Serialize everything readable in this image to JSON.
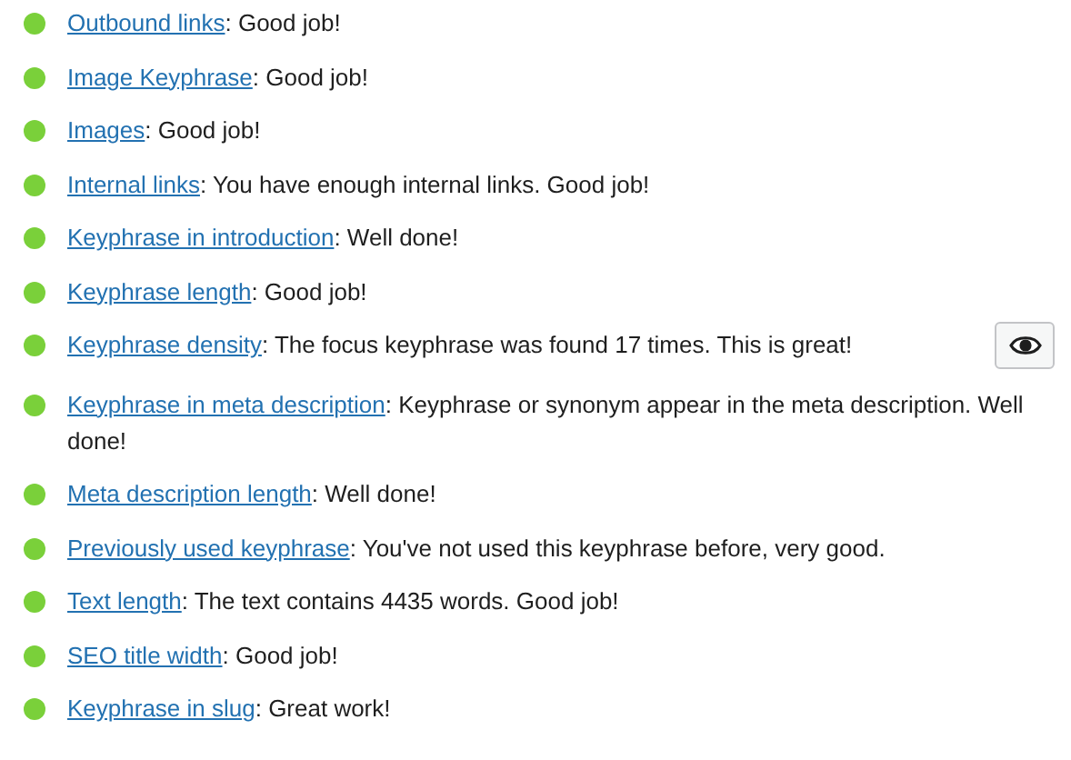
{
  "results": [
    {
      "link": "Outbound links",
      "text": ": Good job!",
      "color": "#7ad03a",
      "eye_button": false
    },
    {
      "link": "Image Keyphrase",
      "text": ": Good job!",
      "color": "#7ad03a",
      "eye_button": false
    },
    {
      "link": "Images",
      "text": ": Good job!",
      "color": "#7ad03a",
      "eye_button": false
    },
    {
      "link": "Internal links",
      "text": ": You have enough internal links. Good job!",
      "color": "#7ad03a",
      "eye_button": false
    },
    {
      "link": "Keyphrase in introduction",
      "text": ": Well done!",
      "color": "#7ad03a",
      "eye_button": false
    },
    {
      "link": "Keyphrase length",
      "text": ": Good job!",
      "color": "#7ad03a",
      "eye_button": false
    },
    {
      "link": "Keyphrase density",
      "text": ": The focus keyphrase was found 17 times. This is great!",
      "color": "#7ad03a",
      "eye_button": true
    },
    {
      "link": "Keyphrase in meta description",
      "text": ": Keyphrase or synonym appear in the meta description. Well done!",
      "color": "#7ad03a",
      "eye_button": false
    },
    {
      "link": "Meta description length",
      "text": ": Well done!",
      "color": "#7ad03a",
      "eye_button": false
    },
    {
      "link": "Previously used keyphrase",
      "text": ": You've not used this keyphrase before, very good.",
      "color": "#7ad03a",
      "eye_button": false
    },
    {
      "link": "Text length",
      "text": ": The text contains 4435 words. Good job!",
      "color": "#7ad03a",
      "eye_button": false
    },
    {
      "link": "SEO title width",
      "text": ": Good job!",
      "color": "#7ad03a",
      "eye_button": false
    },
    {
      "link": "Keyphrase in slug",
      "text": ": Great work!",
      "color": "#7ad03a",
      "eye_button": false
    }
  ]
}
